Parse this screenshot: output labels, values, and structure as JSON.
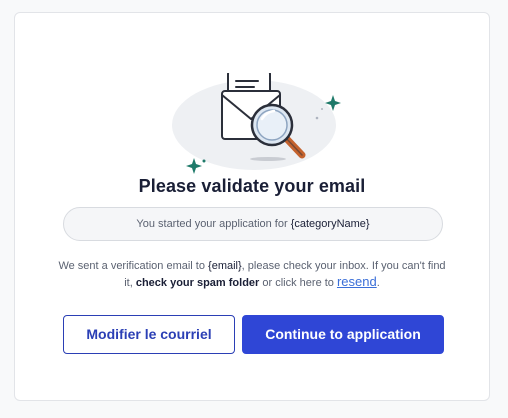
{
  "card": {
    "title": "Please validate your email",
    "application_prefix": "You started your application for ",
    "application_category": "{categoryName}",
    "info": {
      "part1": "We sent a verification email to ",
      "email": "{email}",
      "part2": ", please check your inbox. If you can't find it, ",
      "spam_bold": "check your spam folder",
      "part3": " or click here to ",
      "resend_link": "resend",
      "part4": "."
    }
  },
  "buttons": {
    "modify_label": "Modifier le courriel",
    "continue_label": "Continue to application"
  },
  "colors": {
    "primary": "#2f46d6",
    "secondary_border": "#2b3fb5",
    "sparkle": "#1f7a6a",
    "magnifier_handle": "#c4622d"
  },
  "icons": {
    "illustration": "email-magnifier-illustration",
    "sparkles": "sparkle-icon"
  }
}
